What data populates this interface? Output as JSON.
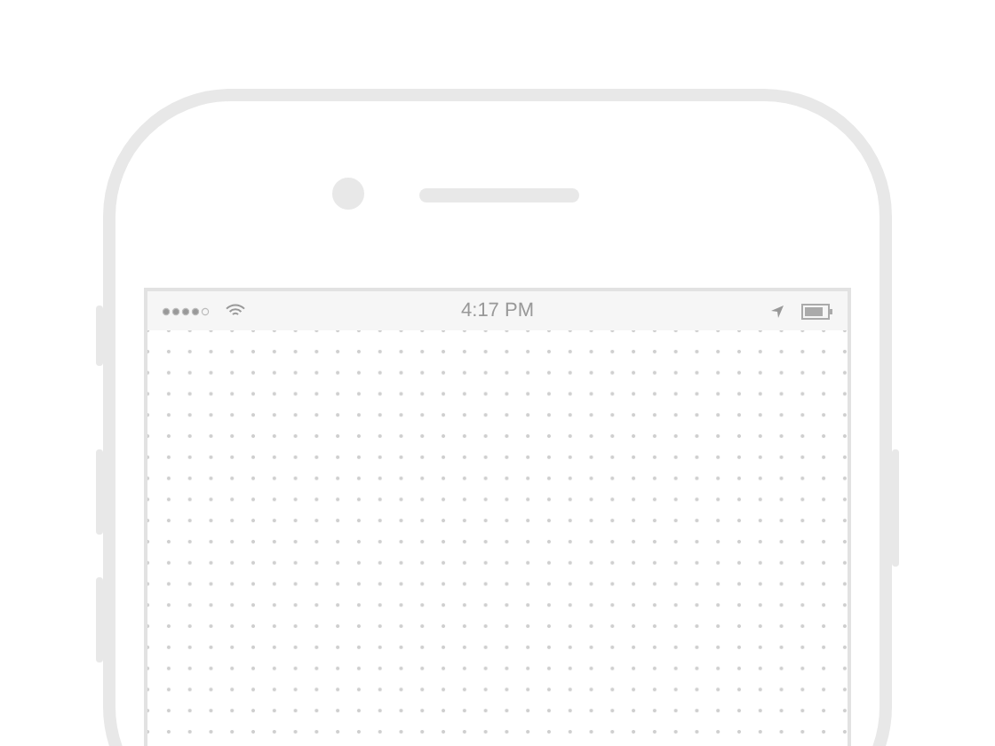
{
  "status_bar": {
    "time": "4:17 PM"
  }
}
